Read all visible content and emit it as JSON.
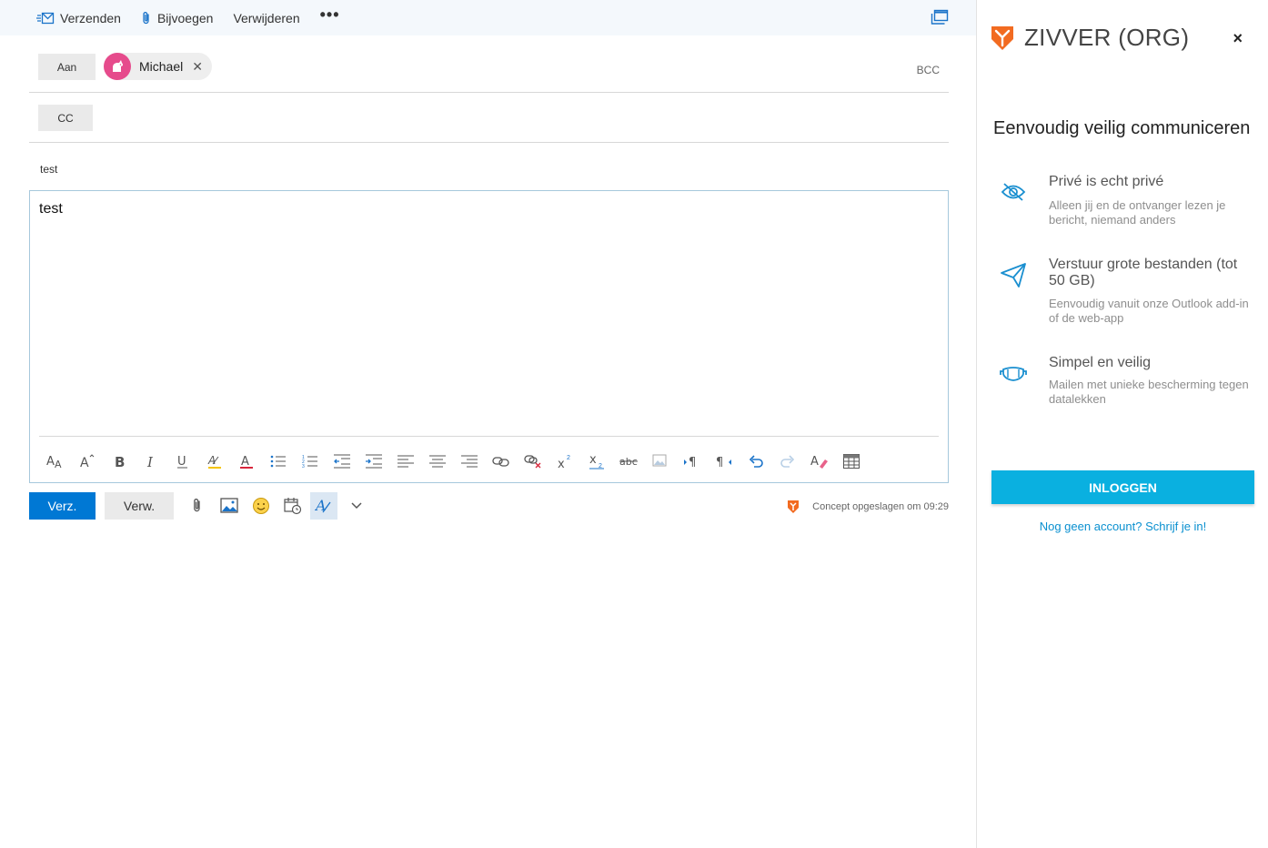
{
  "toolbar": {
    "send_label": "Verzenden",
    "attach_label": "Bijvoegen",
    "delete_label": "Verwijderen",
    "more_label": "•••"
  },
  "compose": {
    "to_label": "Aan",
    "recipient_name": "Michael",
    "bcc_label": "BCC",
    "cc_label": "CC",
    "subject": "test",
    "body": "test"
  },
  "actions": {
    "send_label": "Verz.",
    "discard_label": "Verw.",
    "status": "Concept opgeslagen om 09:29"
  },
  "pane": {
    "title": "ZIVVER (ORG)",
    "close": "×",
    "heading": "Eenvoudig veilig communiceren",
    "features": [
      {
        "title": "Privé is echt privé",
        "desc": "Alleen jij en de ontvanger lezen je bericht, niemand anders",
        "icon": "eye-off-icon"
      },
      {
        "title": "Verstuur grote bestanden (tot 50 GB)",
        "desc": "Eenvoudig vanuit onze Outlook add-in of de web-app",
        "icon": "paper-plane-icon"
      },
      {
        "title": "Simpel en veilig",
        "desc": "Mailen met unieke bescherming tegen datalekken",
        "icon": "mask-icon"
      }
    ],
    "login_label": "INLOGGEN",
    "signup_label": "Nog geen account? Schrijf je in!"
  },
  "colors": {
    "accent_blue": "#0078d4",
    "zivver_cyan": "#0ab0e0",
    "zivver_orange": "#f26b21",
    "icon_blue": "#1a8fd0"
  }
}
